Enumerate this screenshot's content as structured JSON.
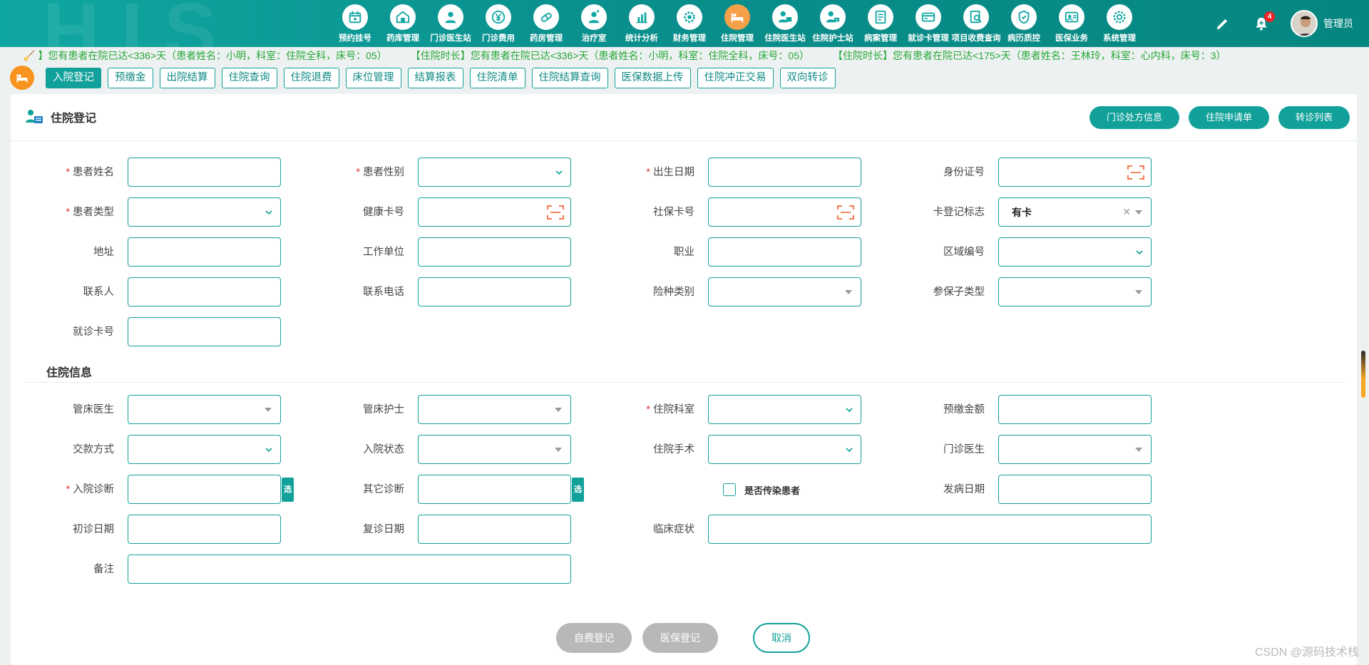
{
  "nav": {
    "items": [
      {
        "label": "预约挂号",
        "icon": "calendar-icon"
      },
      {
        "label": "药库管理",
        "icon": "warehouse-icon"
      },
      {
        "label": "门诊医生站",
        "icon": "doctor-icon"
      },
      {
        "label": "门诊费用",
        "icon": "yen-icon"
      },
      {
        "label": "药房管理",
        "icon": "pill-icon"
      },
      {
        "label": "治疗室",
        "icon": "nurse-icon"
      },
      {
        "label": "统计分析",
        "icon": "chart-icon"
      },
      {
        "label": "财务管理",
        "icon": "gear-icon"
      },
      {
        "label": "住院管理",
        "icon": "bed-icon"
      },
      {
        "label": "住院医生站",
        "icon": "doctor-desk-icon"
      },
      {
        "label": "住院护士站",
        "icon": "nurse-desk-icon"
      },
      {
        "label": "病案管理",
        "icon": "folder-icon"
      },
      {
        "label": "就诊卡管理",
        "icon": "card-icon"
      },
      {
        "label": "项目收费查询",
        "icon": "search-doc-icon"
      },
      {
        "label": "病历质控",
        "icon": "shield-icon"
      },
      {
        "label": "医保业务",
        "icon": "id-card-icon"
      },
      {
        "label": "系统管理",
        "icon": "settings-icon"
      }
    ],
    "active_index": 8,
    "notification_count": "4",
    "user_name": "管理员"
  },
  "marquee": [
    "】您有患者在院已达<336>天（患者姓名：小明，科室：住院全科，床号：05）",
    "【住院时长】您有患者在院已达<336>天（患者姓名：小明，科室：住院全科，床号：05）",
    "【住院时长】您有患者在院已达<175>天（患者姓名：王林玲，科室：心内科，床号：3）"
  ],
  "tabs": [
    "入院登记",
    "预缴金",
    "出院结算",
    "住院查询",
    "住院退费",
    "床位管理",
    "结算报表",
    "住院清单",
    "住院结算查询",
    "医保数据上传",
    "住院冲正交易",
    "双向转诊"
  ],
  "card": {
    "title": "住院登记",
    "buttons": [
      "门诊处方信息",
      "住院申请单",
      "转诊列表"
    ]
  },
  "patient": {
    "name": "患者姓名",
    "gender": "患者性别",
    "birth": "出生日期",
    "id_no": "身份证号",
    "type": "患者类型",
    "health_card": "健康卡号",
    "social_card": "社保卡号",
    "card_flag": "卡登记标志",
    "card_flag_value": "有卡",
    "address": "地址",
    "work_unit": "工作单位",
    "job": "职业",
    "region": "区域编号",
    "contact": "联系人",
    "contact_phone": "联系电话",
    "insurance_type": "险种类别",
    "insurance_sub": "参保子类型",
    "visit_card": "就诊卡号"
  },
  "inpatient": {
    "section_title": "住院信息",
    "bed_doctor": "管床医生",
    "bed_nurse": "管床护士",
    "department": "住院科室",
    "prepay": "预缴金额",
    "pay_method": "交款方式",
    "admit_status": "入院状态",
    "surgery": "住院手术",
    "outpatient_doctor": "门诊医生",
    "admit_diag": "入院诊断",
    "other_diag": "其它诊断",
    "select_label": "选",
    "infectious": "是否传染患者",
    "onset_date": "发病日期",
    "first_date": "初诊日期",
    "revisit_date": "复诊日期",
    "symptoms": "临床症状",
    "remark": "备注"
  },
  "footer": {
    "self_pay": "自费登记",
    "insurance": "医保登记",
    "cancel": "取消"
  },
  "watermark": "CSDN @源码技术栈"
}
